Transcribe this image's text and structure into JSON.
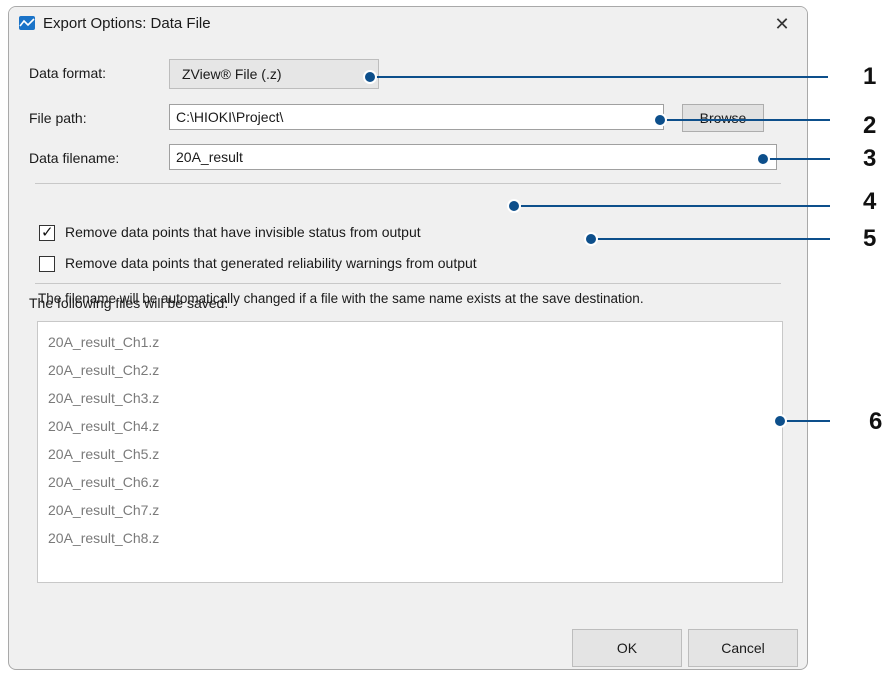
{
  "window": {
    "title": "Export Options: Data File",
    "close_glyph": "✕",
    "icon": "app-graph-icon"
  },
  "form": {
    "data_format_label": "Data format:",
    "data_format_value": "ZView® File (.z)",
    "file_path_label": "File path:",
    "file_path_value": "C:\\HIOKI\\Project\\",
    "browse_label": "Browse",
    "data_filename_label": "Data filename:",
    "data_filename_value": "20A_result"
  },
  "options": [
    {
      "label": "Remove data points that have invisible status from output",
      "checked": true
    },
    {
      "label": "Remove data points that generated reliability warnings from output",
      "checked": false
    }
  ],
  "files": {
    "heading": "The following files will be saved:",
    "note": "The filename will be automatically changed if a file with the same name exists at the save destination.",
    "items": [
      "20A_result_Ch1.z",
      "20A_result_Ch2.z",
      "20A_result_Ch3.z",
      "20A_result_Ch4.z",
      "20A_result_Ch5.z",
      "20A_result_Ch6.z",
      "20A_result_Ch7.z",
      "20A_result_Ch8.z"
    ]
  },
  "buttons": {
    "ok": "OK",
    "cancel": "Cancel"
  },
  "callouts": [
    "1",
    "2",
    "3",
    "4",
    "5",
    "6"
  ],
  "colors": {
    "callout": "#0d4f8b",
    "accent": "#1a73c8"
  }
}
